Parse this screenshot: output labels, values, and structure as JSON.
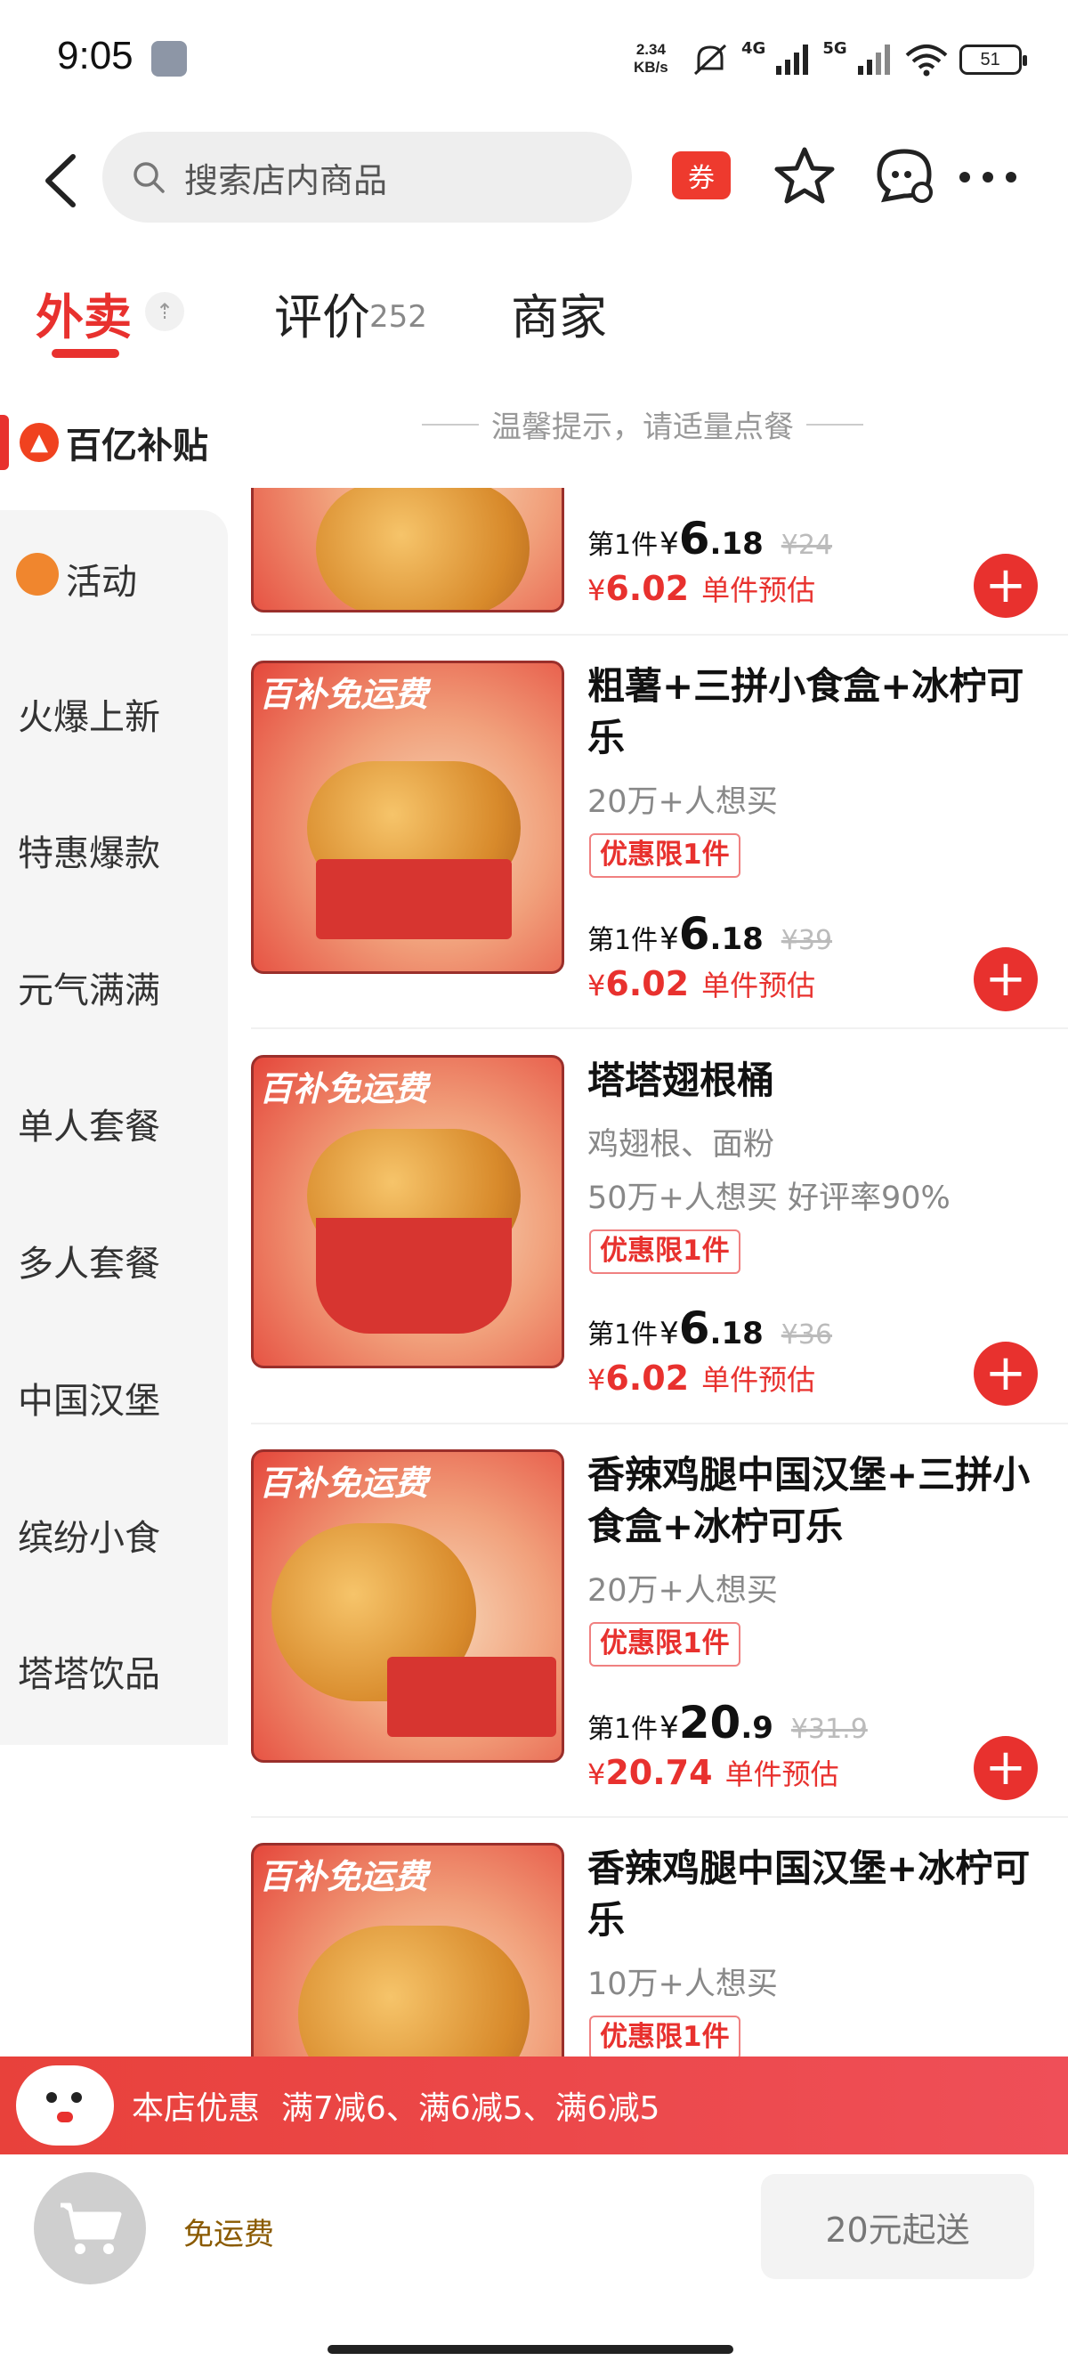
{
  "status_bar": {
    "time": "9:05",
    "speed_top": "2.34",
    "speed_bottom": "KB/s",
    "network_1": "4G",
    "network_2": "5G",
    "battery": "51"
  },
  "header": {
    "search_placeholder": "搜索店内商品",
    "coupon_label": "券"
  },
  "tabs": [
    {
      "label": "外卖"
    },
    {
      "label": "评价",
      "count": "252"
    },
    {
      "label": "商家"
    }
  ],
  "subsidy": {
    "label": "百亿补贴"
  },
  "tip": "温馨提示，请适量点餐",
  "sidebar": {
    "items": [
      {
        "label": "活动"
      },
      {
        "label": "火爆上新"
      },
      {
        "label": "特惠爆款"
      },
      {
        "label": "元气满满"
      },
      {
        "label": "单人套餐"
      },
      {
        "label": "多人套餐"
      },
      {
        "label": "中国汉堡"
      },
      {
        "label": "缤纷小食"
      },
      {
        "label": "塔塔饮品"
      }
    ]
  },
  "products": [
    {
      "first_label": "第1件",
      "yen": "¥",
      "price_big": "6",
      "price_small": ".18",
      "original": "¥24",
      "est_yen": "¥",
      "est_value": "6.02",
      "est_label": "单件预估"
    },
    {
      "badge": "百补免运费",
      "name": "粗薯+三拼小食盒+冰柠可乐",
      "desc": "20万+人想买",
      "limit": "优惠限1件",
      "first_label": "第1件",
      "yen": "¥",
      "price_big": "6",
      "price_small": ".18",
      "original": "¥39",
      "est_yen": "¥",
      "est_value": "6.02",
      "est_label": "单件预估"
    },
    {
      "badge": "百补免运费",
      "name": "塔塔翅根桶",
      "desc_1": "鸡翅根、面粉",
      "desc_2": "50万+人想买 好评率90%",
      "limit": "优惠限1件",
      "first_label": "第1件",
      "yen": "¥",
      "price_big": "6",
      "price_small": ".18",
      "original": "¥36",
      "est_yen": "¥",
      "est_value": "6.02",
      "est_label": "单件预估"
    },
    {
      "badge": "百补免运费",
      "name": "香辣鸡腿中国汉堡+三拼小食盒+冰柠可乐",
      "desc": "20万+人想买",
      "limit": "优惠限1件",
      "first_label": "第1件",
      "yen": "¥",
      "price_big": "20",
      "price_small": ".9",
      "original": "¥31.9",
      "est_yen": "¥",
      "est_value": "20.74",
      "est_label": "单件预估"
    },
    {
      "badge": "百补免运费",
      "name": "香辣鸡腿中国汉堡+冰柠可乐",
      "desc": "10万+人想买",
      "limit": "优惠限1件"
    }
  ],
  "promo": {
    "label": "本店优惠",
    "rules": "满7减6、满6减5、满6减5"
  },
  "cart_bar": {
    "free_shipping": "免运费",
    "min_order": "20元起送"
  },
  "colors": {
    "accent": "#e8312e",
    "promo_bar": "#ea4444",
    "sidebar_bg": "#f5f5f5"
  }
}
